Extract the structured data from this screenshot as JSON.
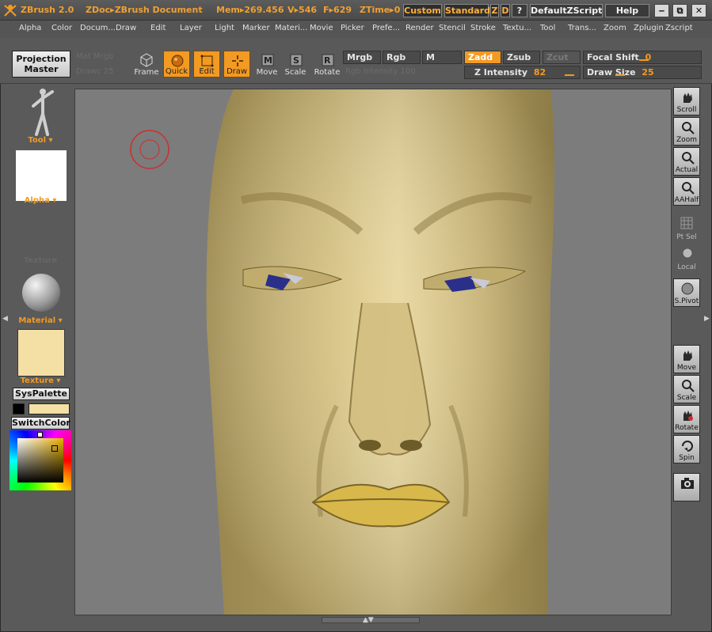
{
  "titlebar": {
    "app": "ZBrush 2.0",
    "doc": "ZDoc▸ZBrush Document",
    "mem": "Mem▸269.456",
    "verts": "V▸546",
    "faces": "F▸629",
    "ztime": "ZTime▸0",
    "custom": "Custom",
    "standard": "Standard",
    "z": "Z",
    "d": "D",
    "question": "?",
    "defaultscript": "DefaultZScript",
    "help": "Help",
    "minimize": "‒",
    "restore": "⧉",
    "close": "✕"
  },
  "menu": [
    "Alpha",
    "Color",
    "Docum...",
    "Draw",
    "Edit",
    "Layer",
    "Light",
    "Marker",
    "Materi...",
    "Movie",
    "Picker",
    "Prefe...",
    "Render",
    "Stencil",
    "Stroke",
    "Textu...",
    "Tool",
    "Trans...",
    "Zoom",
    "Zplugin",
    "Zscript"
  ],
  "toolbar": {
    "projection_master": "Projection\nMaster",
    "ghost_left_top": "Mat    Mrgb",
    "ghost_left_bottom": "Drawc 25",
    "frame": "Frame",
    "quick": "Quick",
    "edit": "Edit",
    "draw": "Draw",
    "move": "Move",
    "scale": "Scale",
    "rotate": "Rotate",
    "mrgb": "Mrgb",
    "rgb": "Rgb",
    "m": "M",
    "zadd": "Zadd",
    "zsub": "Zsub",
    "zcut": "Zcut",
    "rgb_intensity": "Rgb Intensity 100",
    "z_intensity_label": "Z Intensity",
    "z_intensity_value": "82",
    "focal_shift_label": "Focal Shift",
    "focal_shift_value": "0",
    "draw_size_label": "Draw Size",
    "draw_size_value": "25"
  },
  "left": {
    "tool": "Tool",
    "alpha": "Alpha",
    "texture_ghost": "Texture",
    "material": "Material",
    "texture": "Texture",
    "syspalette": "SysPalette",
    "switchcolor": "SwitchColor"
  },
  "right": [
    {
      "id": "scroll",
      "label": "Scroll"
    },
    {
      "id": "zoom",
      "label": "Zoom"
    },
    {
      "id": "actual",
      "label": "Actual"
    },
    {
      "id": "aahalf",
      "label": "AAHalf"
    },
    {
      "id": "ptsel",
      "label": "Pt Sel"
    },
    {
      "id": "local",
      "label": "Local"
    },
    {
      "id": "spivot",
      "label": "S.Pivot"
    },
    {
      "id": "move",
      "label": "Move"
    },
    {
      "id": "scale",
      "label": "Scale"
    },
    {
      "id": "rotate",
      "label": "Rotate"
    },
    {
      "id": "spin",
      "label": "Spin"
    },
    {
      "id": "snapshot",
      "label": ""
    }
  ],
  "colors": {
    "accent": "#f39a22",
    "face": "#d8c48a",
    "main_color": "#f4e0a4",
    "secondary_color": "#000000"
  }
}
